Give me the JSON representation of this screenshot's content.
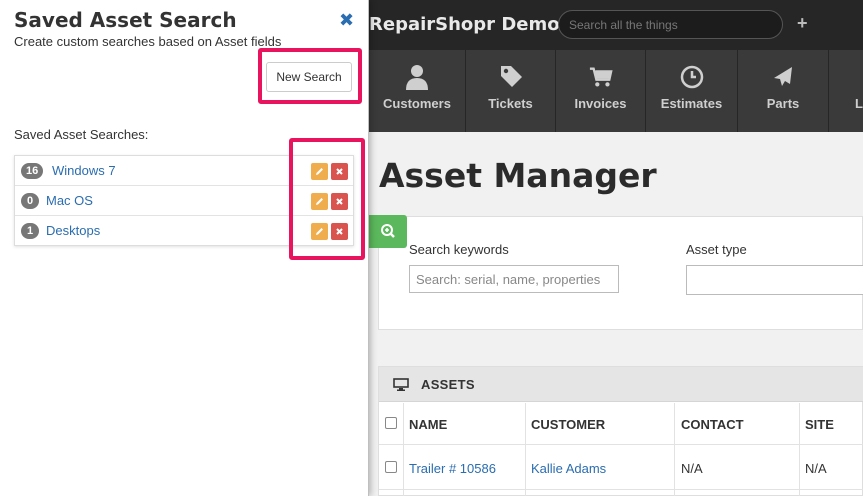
{
  "side_panel": {
    "title": "Saved Asset Search",
    "subtitle": "Create custom searches based on Asset fields",
    "close_icon": "close-icon",
    "new_search_label": "New Search",
    "saved_label": "Saved Asset Searches:",
    "saved_searches": [
      {
        "count": "16",
        "name": "Windows 7"
      },
      {
        "count": "0",
        "name": "Mac OS"
      },
      {
        "count": "1",
        "name": "Desktops"
      }
    ],
    "highlight_color": "#e8145e"
  },
  "app": {
    "brand": "RepairShopr Demo",
    "search_placeholder": "Search all the things",
    "nav": [
      {
        "label": "Customers",
        "icon": "user-icon"
      },
      {
        "label": "Tickets",
        "icon": "tag-icon"
      },
      {
        "label": "Invoices",
        "icon": "cart-icon"
      },
      {
        "label": "Estimates",
        "icon": "clock-icon"
      },
      {
        "label": "Parts",
        "icon": "plane-icon"
      },
      {
        "label": "L",
        "icon": "unknown-icon"
      }
    ]
  },
  "main": {
    "title": "Asset Manager",
    "search_keywords_label": "Search keywords",
    "search_keywords_placeholder": "Search: serial, name, properties",
    "asset_type_label": "Asset type",
    "filter_icon": "zoom-in-icon",
    "filter_button_color": "#5cb85c"
  },
  "assets": {
    "title": "ASSETS",
    "icon": "monitor-icon",
    "columns": [
      "NAME",
      "CUSTOMER",
      "CONTACT",
      "SITE"
    ],
    "rows": [
      {
        "name": "Trailer # 10586",
        "customer": "Kallie Adams",
        "contact": "N/A",
        "site": "N/A"
      }
    ]
  }
}
